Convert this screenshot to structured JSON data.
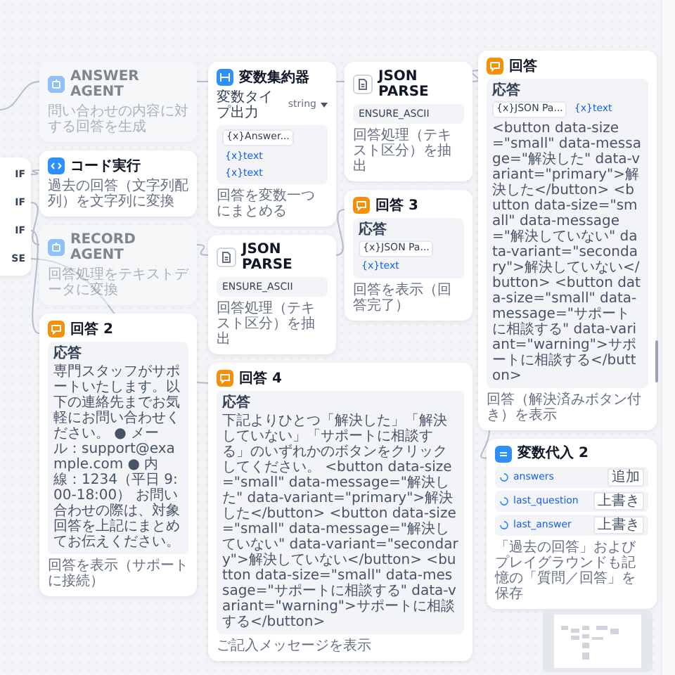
{
  "nodes": [
    {
      "kind": "ifelse",
      "disabled": false,
      "branches": [
        "IF",
        "IF",
        "IF",
        "SE"
      ]
    },
    {
      "kind": "agent",
      "title": "ANSWER AGENT",
      "disabled": true,
      "description": "問い合わせの内容に対する回答を生成"
    },
    {
      "kind": "aggregator",
      "title": "変数集約器",
      "disabled": false,
      "output_label": "変数タイプ出力",
      "output_type": "string",
      "rows": [
        [
          {
            "kind": "node",
            "text": "{x}Answer..."
          },
          {
            "kind": "var",
            "text": "{x}text"
          }
        ],
        [
          {
            "kind": "var",
            "text": "{x}text"
          }
        ]
      ],
      "description": "回答を変数一つにまとめる"
    },
    {
      "kind": "json_parse",
      "title": "JSON PARSE",
      "disabled": false,
      "param": "ENSURE_ASCII",
      "description": "回答処理（テキスト区分）を抽出"
    },
    {
      "kind": "answer",
      "title": "回答",
      "disabled": false,
      "label": "応答",
      "content": [
        {
          "kind": "node",
          "text": "{x}JSON Pa..."
        },
        {
          "kind": "var",
          "text": "{x}text"
        },
        {
          "kind": "text",
          "text": "<button data-size=\"small\" data-message=\"解決した\" data-variant=\"primary\">解決した</button> <button data-size=\"small\" data-message=\"解決していない\" data-variant=\"secondary\">解決していない</button> <button data-size=\"small\" data-message=\"サポートに相談する\" data-variant=\"warning\">サポートに相談する</button>"
        }
      ],
      "description": "回答（解決済みボタン付き）を表示"
    },
    {
      "kind": "code",
      "title": "コード実行",
      "disabled": false,
      "description": "過去の回答（文字列配列）を文字列に変換"
    },
    {
      "kind": "agent",
      "title": "RECORD AGENT",
      "disabled": true,
      "description": "回答処理をテキストデータに変換"
    },
    {
      "kind": "json_parse",
      "title": "JSON PARSE",
      "disabled": false,
      "param": "ENSURE_ASCII",
      "description": "回答処理（テキスト区分）を抽出"
    },
    {
      "kind": "answer",
      "title": "回答 3",
      "disabled": false,
      "label": "応答",
      "content": [
        {
          "kind": "node",
          "text": "{x}JSON Pa..."
        },
        {
          "kind": "var",
          "text": "{x}text"
        }
      ],
      "description": "回答を表示（回答完了）"
    },
    {
      "kind": "answer",
      "title": "回答 2",
      "disabled": false,
      "label": "応答",
      "content": [
        {
          "kind": "text",
          "text": "専門スタッフがサポートいたします。以下の連絡先までお気軽にお問い合わせください。 ● メール：support@example.com ● 内線：1234（平日 9:00-18:00） お問い合わせの際は、対象回答を上記にまとめてお伝えください。"
        }
      ],
      "description": "回答を表示（サポートに接続）"
    },
    {
      "kind": "assigner",
      "title": "変数代入 2",
      "disabled": false,
      "rows": [
        {
          "name": "answers",
          "op": "追加"
        },
        {
          "name": "last_question",
          "op": "上書き"
        },
        {
          "name": "last_answer",
          "op": "上書き"
        }
      ],
      "description": "「過去の回答」およびプレイグラウンドも記憶の「質問／回答」を保存"
    },
    {
      "kind": "answer",
      "title": "回答 4",
      "disabled": false,
      "label": "応答",
      "content": [
        {
          "kind": "text",
          "text": "下記よりひとつ「解決した」「解決していない」「サポートに相談する」のいずれかのボタンをクリックしてください。 <button data-size=\"small\" data-message=\"解決した\" data-variant=\"primary\">解決した</button> <button data-size=\"small\" data-message=\"解決していない\" data-variant=\"secondary\">解決していない</button> <button data-size=\"small\" data-message=\"サポートに相談する\" data-variant=\"warning\">サポートに相談する</button>"
        }
      ],
      "description": "ご記入メッセージを表示"
    }
  ]
}
